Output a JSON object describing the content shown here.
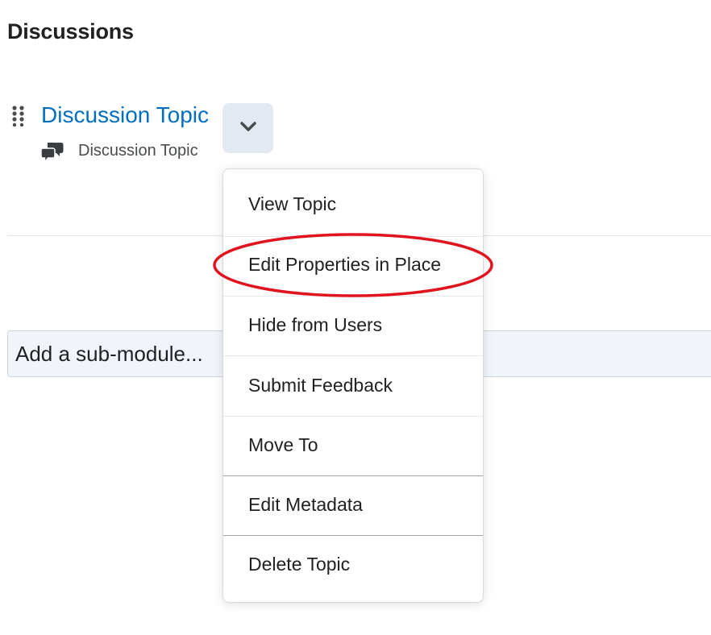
{
  "page": {
    "title": "Discussions"
  },
  "topic": {
    "link_label": "Discussion Topic",
    "type_label": "Discussion Topic",
    "type_icon": "discussion-bubbles-icon"
  },
  "actions_button": {
    "icon": "chevron-down-icon"
  },
  "submodule": {
    "placeholder": "Add a sub-module..."
  },
  "menu": {
    "items": [
      {
        "label": "View Topic"
      },
      {
        "label": "Edit Properties in Place"
      },
      {
        "label": "Hide from Users"
      },
      {
        "label": "Submit Feedback"
      },
      {
        "label": "Move To"
      },
      {
        "label": "Edit Metadata"
      },
      {
        "label": "Delete Topic"
      }
    ],
    "highlighted_index": 1
  },
  "colors": {
    "link": "#006fbf",
    "button_bg": "#e3e9f1",
    "highlight": "#e0141e"
  }
}
